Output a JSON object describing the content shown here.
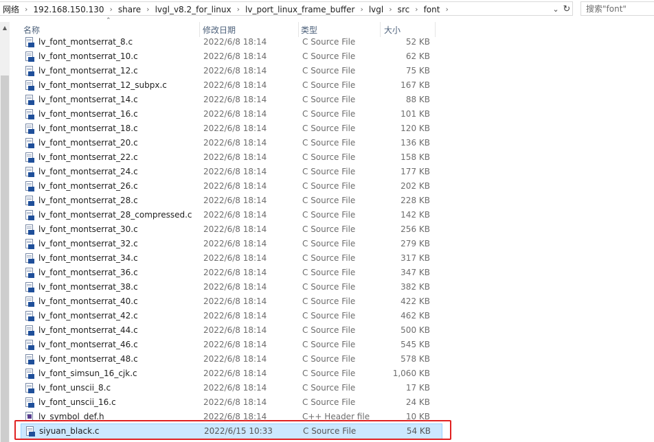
{
  "addressbar": {
    "breadcrumbs": [
      "网络",
      "192.168.150.130",
      "share",
      "lvgl_v8.2_for_linux",
      "lv_port_linux_frame_buffer",
      "lvgl",
      "src",
      "font"
    ],
    "dropdown_icon": "chevron-down-icon",
    "refresh_icon": "refresh-icon"
  },
  "search": {
    "placeholder": "搜索\"font\"",
    "value": ""
  },
  "columns": {
    "name": "名称",
    "date": "修改日期",
    "type": "类型",
    "size": "大小"
  },
  "files": [
    {
      "name": "lv_font_montserrat_8.c",
      "date": "2022/6/8 18:14",
      "type": "C Source File",
      "size": "52 KB"
    },
    {
      "name": "lv_font_montserrat_10.c",
      "date": "2022/6/8 18:14",
      "type": "C Source File",
      "size": "62 KB"
    },
    {
      "name": "lv_font_montserrat_12.c",
      "date": "2022/6/8 18:14",
      "type": "C Source File",
      "size": "75 KB"
    },
    {
      "name": "lv_font_montserrat_12_subpx.c",
      "date": "2022/6/8 18:14",
      "type": "C Source File",
      "size": "167 KB"
    },
    {
      "name": "lv_font_montserrat_14.c",
      "date": "2022/6/8 18:14",
      "type": "C Source File",
      "size": "88 KB"
    },
    {
      "name": "lv_font_montserrat_16.c",
      "date": "2022/6/8 18:14",
      "type": "C Source File",
      "size": "101 KB"
    },
    {
      "name": "lv_font_montserrat_18.c",
      "date": "2022/6/8 18:14",
      "type": "C Source File",
      "size": "120 KB"
    },
    {
      "name": "lv_font_montserrat_20.c",
      "date": "2022/6/8 18:14",
      "type": "C Source File",
      "size": "136 KB"
    },
    {
      "name": "lv_font_montserrat_22.c",
      "date": "2022/6/8 18:14",
      "type": "C Source File",
      "size": "158 KB"
    },
    {
      "name": "lv_font_montserrat_24.c",
      "date": "2022/6/8 18:14",
      "type": "C Source File",
      "size": "177 KB"
    },
    {
      "name": "lv_font_montserrat_26.c",
      "date": "2022/6/8 18:14",
      "type": "C Source File",
      "size": "202 KB"
    },
    {
      "name": "lv_font_montserrat_28.c",
      "date": "2022/6/8 18:14",
      "type": "C Source File",
      "size": "228 KB"
    },
    {
      "name": "lv_font_montserrat_28_compressed.c",
      "date": "2022/6/8 18:14",
      "type": "C Source File",
      "size": "142 KB"
    },
    {
      "name": "lv_font_montserrat_30.c",
      "date": "2022/6/8 18:14",
      "type": "C Source File",
      "size": "256 KB"
    },
    {
      "name": "lv_font_montserrat_32.c",
      "date": "2022/6/8 18:14",
      "type": "C Source File",
      "size": "279 KB"
    },
    {
      "name": "lv_font_montserrat_34.c",
      "date": "2022/6/8 18:14",
      "type": "C Source File",
      "size": "317 KB"
    },
    {
      "name": "lv_font_montserrat_36.c",
      "date": "2022/6/8 18:14",
      "type": "C Source File",
      "size": "347 KB"
    },
    {
      "name": "lv_font_montserrat_38.c",
      "date": "2022/6/8 18:14",
      "type": "C Source File",
      "size": "382 KB"
    },
    {
      "name": "lv_font_montserrat_40.c",
      "date": "2022/6/8 18:14",
      "type": "C Source File",
      "size": "422 KB"
    },
    {
      "name": "lv_font_montserrat_42.c",
      "date": "2022/6/8 18:14",
      "type": "C Source File",
      "size": "462 KB"
    },
    {
      "name": "lv_font_montserrat_44.c",
      "date": "2022/6/8 18:14",
      "type": "C Source File",
      "size": "500 KB"
    },
    {
      "name": "lv_font_montserrat_46.c",
      "date": "2022/6/8 18:14",
      "type": "C Source File",
      "size": "545 KB"
    },
    {
      "name": "lv_font_montserrat_48.c",
      "date": "2022/6/8 18:14",
      "type": "C Source File",
      "size": "578 KB"
    },
    {
      "name": "lv_font_simsun_16_cjk.c",
      "date": "2022/6/8 18:14",
      "type": "C Source File",
      "size": "1,060 KB"
    },
    {
      "name": "lv_font_unscii_8.c",
      "date": "2022/6/8 18:14",
      "type": "C Source File",
      "size": "17 KB"
    },
    {
      "name": "lv_font_unscii_16.c",
      "date": "2022/6/8 18:14",
      "type": "C Source File",
      "size": "24 KB"
    },
    {
      "name": "lv_symbol_def.h",
      "date": "2022/6/8 18:14",
      "type": "C++ Header file",
      "size": "10 KB"
    },
    {
      "name": "siyuan_black.c",
      "date": "2022/6/15 10:33",
      "type": "C Source File",
      "size": "54 KB",
      "selected": true
    }
  ],
  "colors": {
    "selection_bg": "#cce8ff",
    "selection_border": "#99d1ff",
    "highlight_box": "#e02020",
    "header_text": "#4c607a"
  }
}
